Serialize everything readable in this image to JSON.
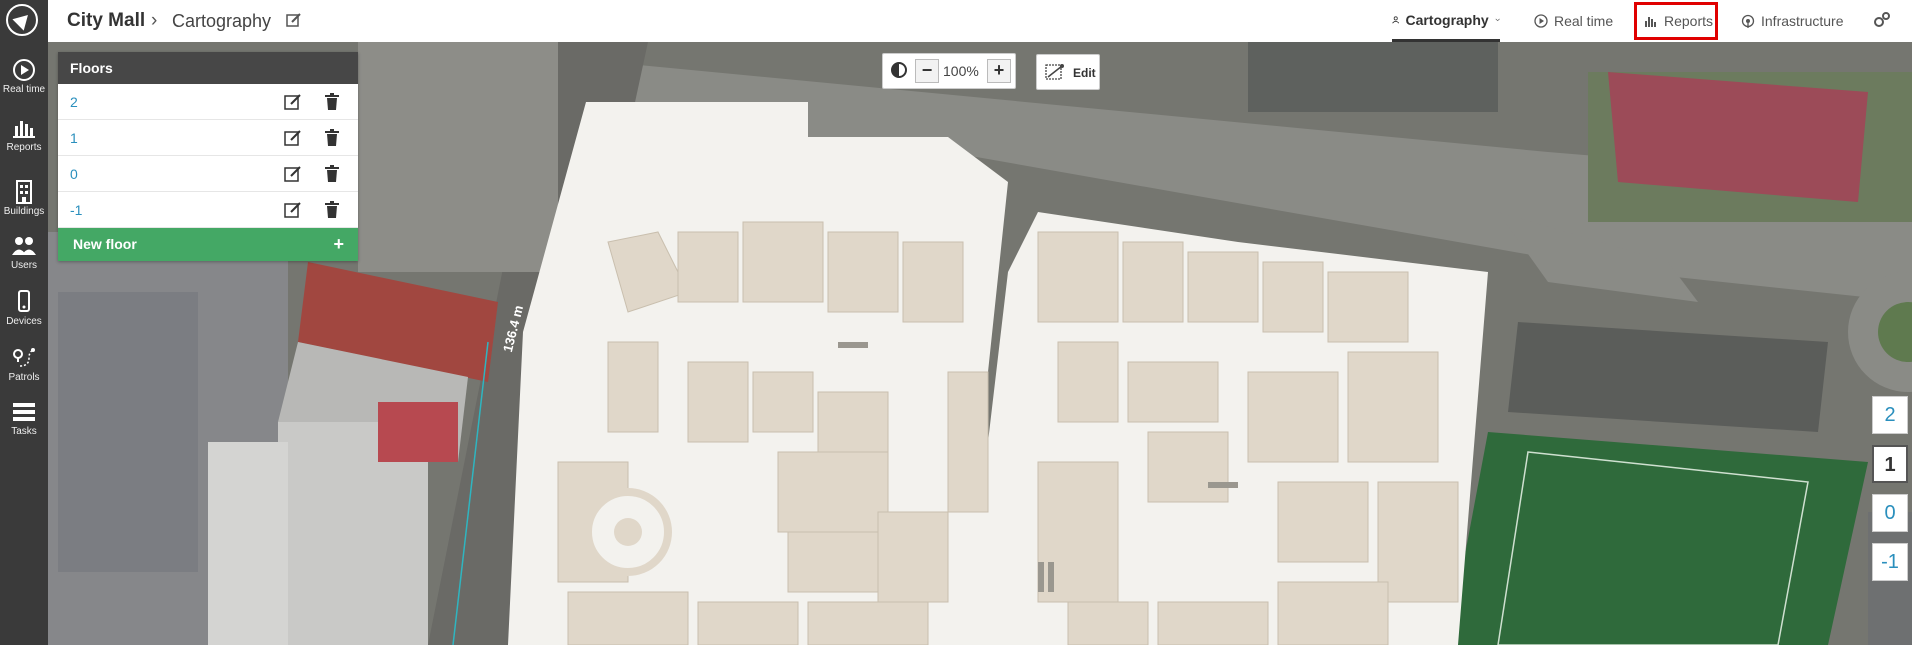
{
  "sidebar": {
    "items": [
      {
        "label": "Real time",
        "icon": "play-circle-icon"
      },
      {
        "label": "Reports",
        "icon": "bar-chart-icon"
      },
      {
        "label": "Buildings",
        "icon": "building-icon"
      },
      {
        "label": "Users",
        "icon": "users-icon"
      },
      {
        "label": "Devices",
        "icon": "phone-icon"
      },
      {
        "label": "Patrols",
        "icon": "route-icon"
      },
      {
        "label": "Tasks",
        "icon": "list-icon"
      }
    ]
  },
  "breadcrumb": {
    "root": "City Mall",
    "separator": "›",
    "leaf": "Cartography"
  },
  "topnav": {
    "cartography": "Cartography",
    "realtime": "Real time",
    "reports": "Reports",
    "infrastructure": "Infrastructure"
  },
  "floors_panel": {
    "title": "Floors",
    "floors": [
      "2",
      "1",
      "0",
      "-1"
    ],
    "new_floor_label": "New floor",
    "new_floor_plus": "+"
  },
  "map_controls": {
    "zoom_minus": "−",
    "zoom_value": "100%",
    "zoom_plus": "+",
    "edit_label": "Edit"
  },
  "floor_selector": {
    "floors": [
      "2",
      "1",
      "0",
      "-1"
    ],
    "active": "1"
  },
  "map": {
    "scale_label": "136.4 m"
  },
  "colors": {
    "sidebar_bg": "#3a3a3a",
    "panel_header": "#474747",
    "new_floor_bg": "#44a865",
    "link_blue": "#2a8fbd",
    "highlight_red": "#e00000"
  }
}
